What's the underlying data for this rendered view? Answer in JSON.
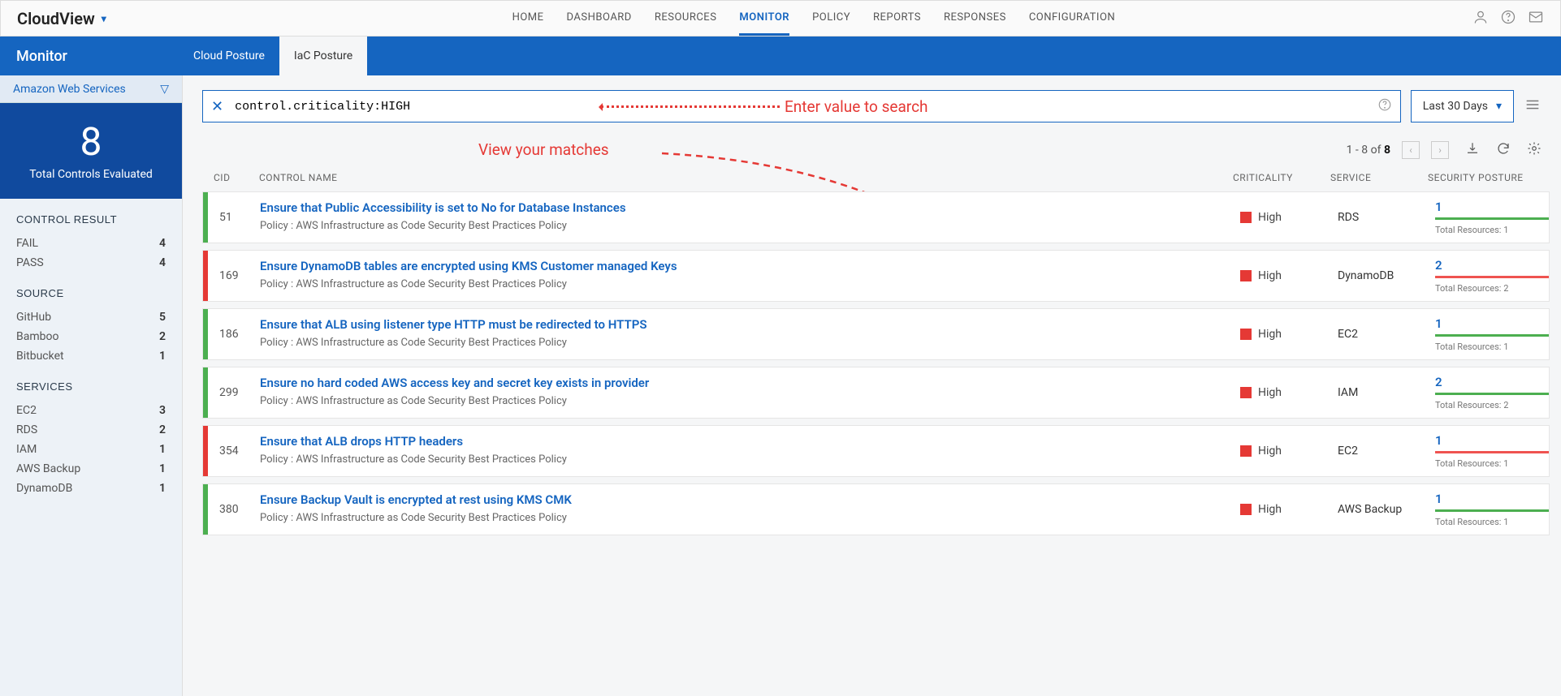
{
  "brand": "CloudView",
  "nav": [
    "HOME",
    "DASHBOARD",
    "RESOURCES",
    "MONITOR",
    "POLICY",
    "REPORTS",
    "RESPONSES",
    "CONFIGURATION"
  ],
  "nav_active": "MONITOR",
  "subtitle": "Monitor",
  "tabs": [
    "Cloud Posture",
    "IaC Posture"
  ],
  "tab_active": "IaC Posture",
  "cloud_selector": "Amazon Web Services",
  "metric": {
    "value": "8",
    "label": "Total Controls Evaluated"
  },
  "facets": {
    "CONTROL RESULT": [
      [
        "FAIL",
        "4"
      ],
      [
        "PASS",
        "4"
      ]
    ],
    "SOURCE": [
      [
        "GitHub",
        "5"
      ],
      [
        "Bamboo",
        "2"
      ],
      [
        "Bitbucket",
        "1"
      ]
    ],
    "SERVICES": [
      [
        "EC2",
        "3"
      ],
      [
        "RDS",
        "2"
      ],
      [
        "IAM",
        "1"
      ],
      [
        "AWS Backup",
        "1"
      ],
      [
        "DynamoDB",
        "1"
      ]
    ]
  },
  "search_value": "control.criticality:HIGH",
  "date_range": "Last 30 Days",
  "annotation_search": "Enter value to search",
  "annotation_matches": "View your matches",
  "pager_text_prefix": "1 - 8 of ",
  "pager_total": "8",
  "columns": [
    "CID",
    "CONTROL NAME",
    "CRITICALITY",
    "SERVICE",
    "SECURITY POSTURE"
  ],
  "policy_line": "Policy : AWS Infrastructure as Code Security Best Practices Policy",
  "rows": [
    {
      "cid": "51",
      "name": "Ensure that Public Accessibility is set to No for Database Instances",
      "crit": "High",
      "svc": "RDS",
      "posture": "1",
      "posture_bar": "green",
      "total": "Total Resources: 1",
      "edge": "green"
    },
    {
      "cid": "169",
      "name": "Ensure DynamoDB tables are encrypted using KMS Customer managed Keys",
      "crit": "High",
      "svc": "DynamoDB",
      "posture": "2",
      "posture_bar": "red",
      "total": "Total Resources: 2",
      "edge": "red"
    },
    {
      "cid": "186",
      "name": "Ensure that ALB using listener type HTTP must be redirected to HTTPS",
      "crit": "High",
      "svc": "EC2",
      "posture": "1",
      "posture_bar": "green",
      "total": "Total Resources: 1",
      "edge": "green"
    },
    {
      "cid": "299",
      "name": "Ensure no hard coded AWS access key and secret key exists in provider",
      "crit": "High",
      "svc": "IAM",
      "posture": "2",
      "posture_bar": "green",
      "total": "Total Resources: 2",
      "edge": "green"
    },
    {
      "cid": "354",
      "name": "Ensure that ALB drops HTTP headers",
      "crit": "High",
      "svc": "EC2",
      "posture": "1",
      "posture_bar": "red",
      "total": "Total Resources: 1",
      "edge": "red"
    },
    {
      "cid": "380",
      "name": "Ensure Backup Vault is encrypted at rest using KMS CMK",
      "crit": "High",
      "svc": "AWS Backup",
      "posture": "1",
      "posture_bar": "green",
      "total": "Total Resources: 1",
      "edge": "green"
    }
  ]
}
